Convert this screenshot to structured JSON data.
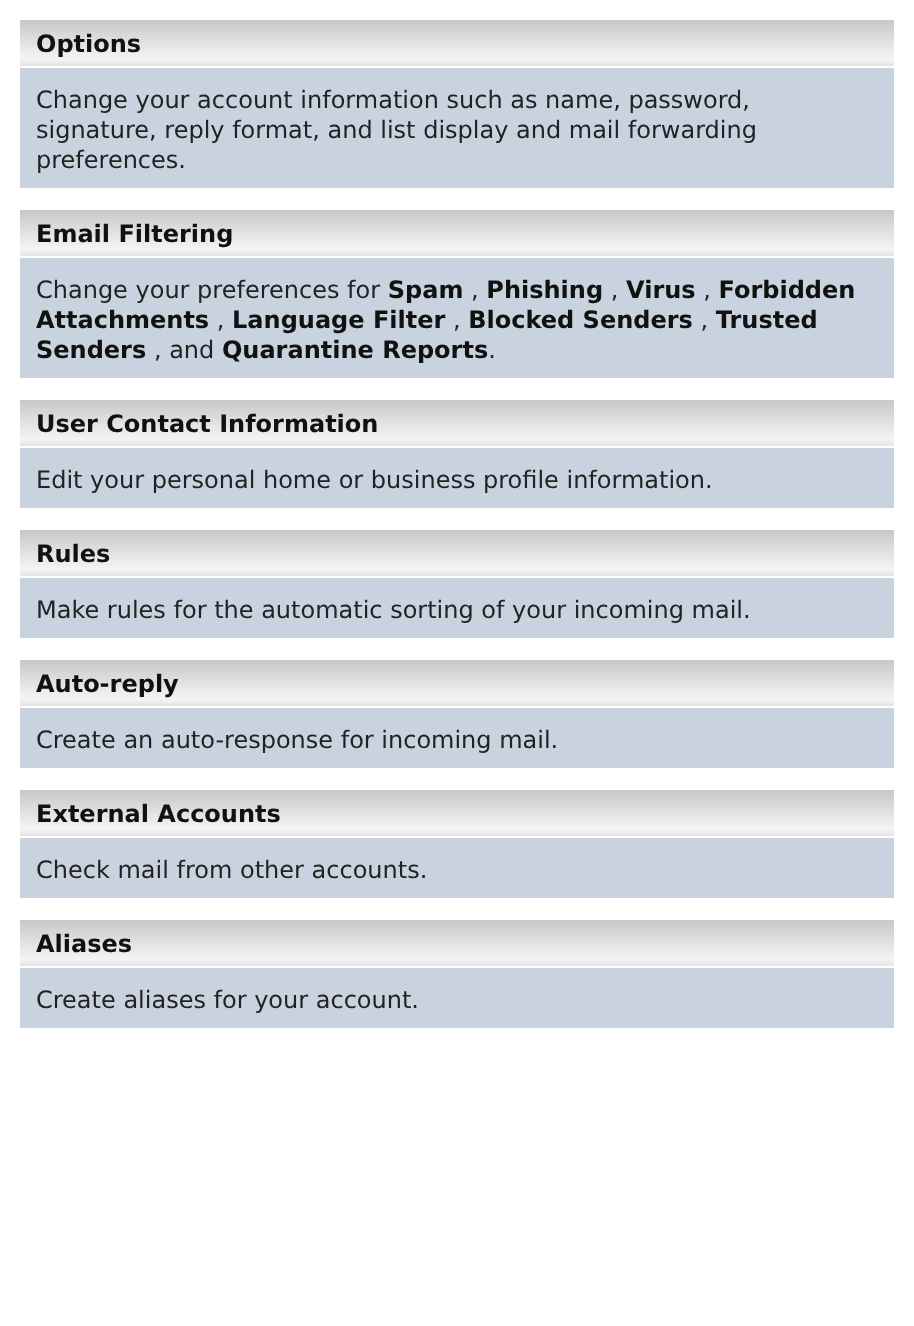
{
  "sections": [
    {
      "title": "Options",
      "description": "Change your account information such as name, password, signature, reply format, and list display and mail forwarding preferences."
    },
    {
      "title": "Email Filtering",
      "description": "Change your preferences for **Spam** , **Phishing** , **Virus** , **Forbidden Attachments** , **Language Filter** , **Blocked Senders** , **Trusted Senders** , and **Quarantine Reports**."
    },
    {
      "title": "User Contact Information",
      "description": "Edit your personal home or business profile information."
    },
    {
      "title": "Rules",
      "description": "Make rules for the automatic sorting of your incoming mail."
    },
    {
      "title": "Auto-reply",
      "description": "Create an auto-response for incoming mail."
    },
    {
      "title": "External Accounts",
      "description": "Check mail from other accounts."
    },
    {
      "title": "Aliases",
      "description": "Create aliases for your account."
    }
  ]
}
